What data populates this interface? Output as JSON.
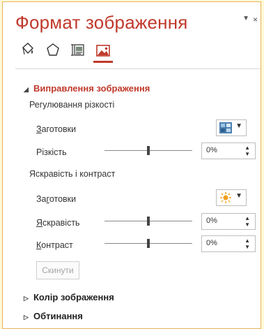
{
  "pane": {
    "title": "Формат зображення",
    "menu_glyph": "▼",
    "close_glyph": "×"
  },
  "tabs": [
    {
      "name": "fill-line-icon",
      "active": false
    },
    {
      "name": "effects-icon",
      "active": false
    },
    {
      "name": "size-properties-icon",
      "active": false
    },
    {
      "name": "picture-icon",
      "active": true
    }
  ],
  "sections": {
    "picture_corrections": {
      "title": "Виправлення зображення",
      "sharpness_group": "Регулювання різкості",
      "presets_label_1": "Заготовки",
      "sharpness_label": "Різкість",
      "sharpness_value": "0%",
      "brightness_contrast_group": "Яскравість і контраст",
      "presets_label_2": "Заготовки",
      "brightness_label": "Яскравість",
      "brightness_value": "0%",
      "contrast_label": "Контраст",
      "contrast_value": "0%",
      "reset_label": "Скинути"
    },
    "picture_color": {
      "title": "Колір зображення"
    },
    "crop": {
      "title": "Обтинання"
    }
  },
  "colors": {
    "accent": "#c0392b",
    "background": "#fff9d6",
    "border": "#e8b25a"
  }
}
